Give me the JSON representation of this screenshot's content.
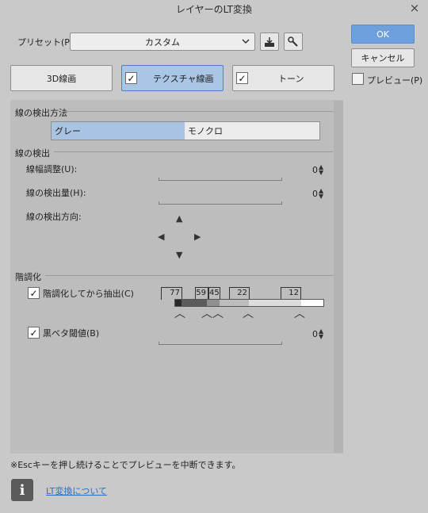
{
  "window": {
    "title": "レイヤーのLT変換",
    "close_glyph": "×"
  },
  "preset": {
    "label": "プリセット(P):",
    "value": "カスタム"
  },
  "side_buttons": {
    "ok": "OK",
    "cancel": "キャンセル",
    "preview": "プレビュー(P)"
  },
  "tabs": {
    "t3d": "3D線画",
    "texture": "テクスチャ線画",
    "tone": "トーン"
  },
  "sections": {
    "detect_method": {
      "title": "線の検出方法",
      "options": [
        "グレー",
        "モノクロ"
      ],
      "selected": "グレー"
    },
    "detect": {
      "title": "線の検出",
      "width_label": "線幅調整(U):",
      "width_value": "0",
      "amount_label": "線の検出量(H):",
      "amount_value": "0",
      "direction_label": "線の検出方向:"
    },
    "posterize": {
      "title": "階調化",
      "extract_label": "階調化してから抽出(C)",
      "levels": [
        "77",
        "59",
        "45",
        "22",
        "12"
      ],
      "black_label": "黒ベタ閾値(B)",
      "black_value": "0"
    }
  },
  "footer": {
    "note": "※Escキーを押し続けることでプレビューを中断できます。",
    "link": "LT変換について"
  },
  "icons": [
    "chevron-down-icon",
    "save-preset-icon",
    "wrench-icon",
    "arrow-up-icon",
    "arrow-left-icon",
    "arrow-right-icon",
    "arrow-down-icon",
    "info-icon"
  ]
}
